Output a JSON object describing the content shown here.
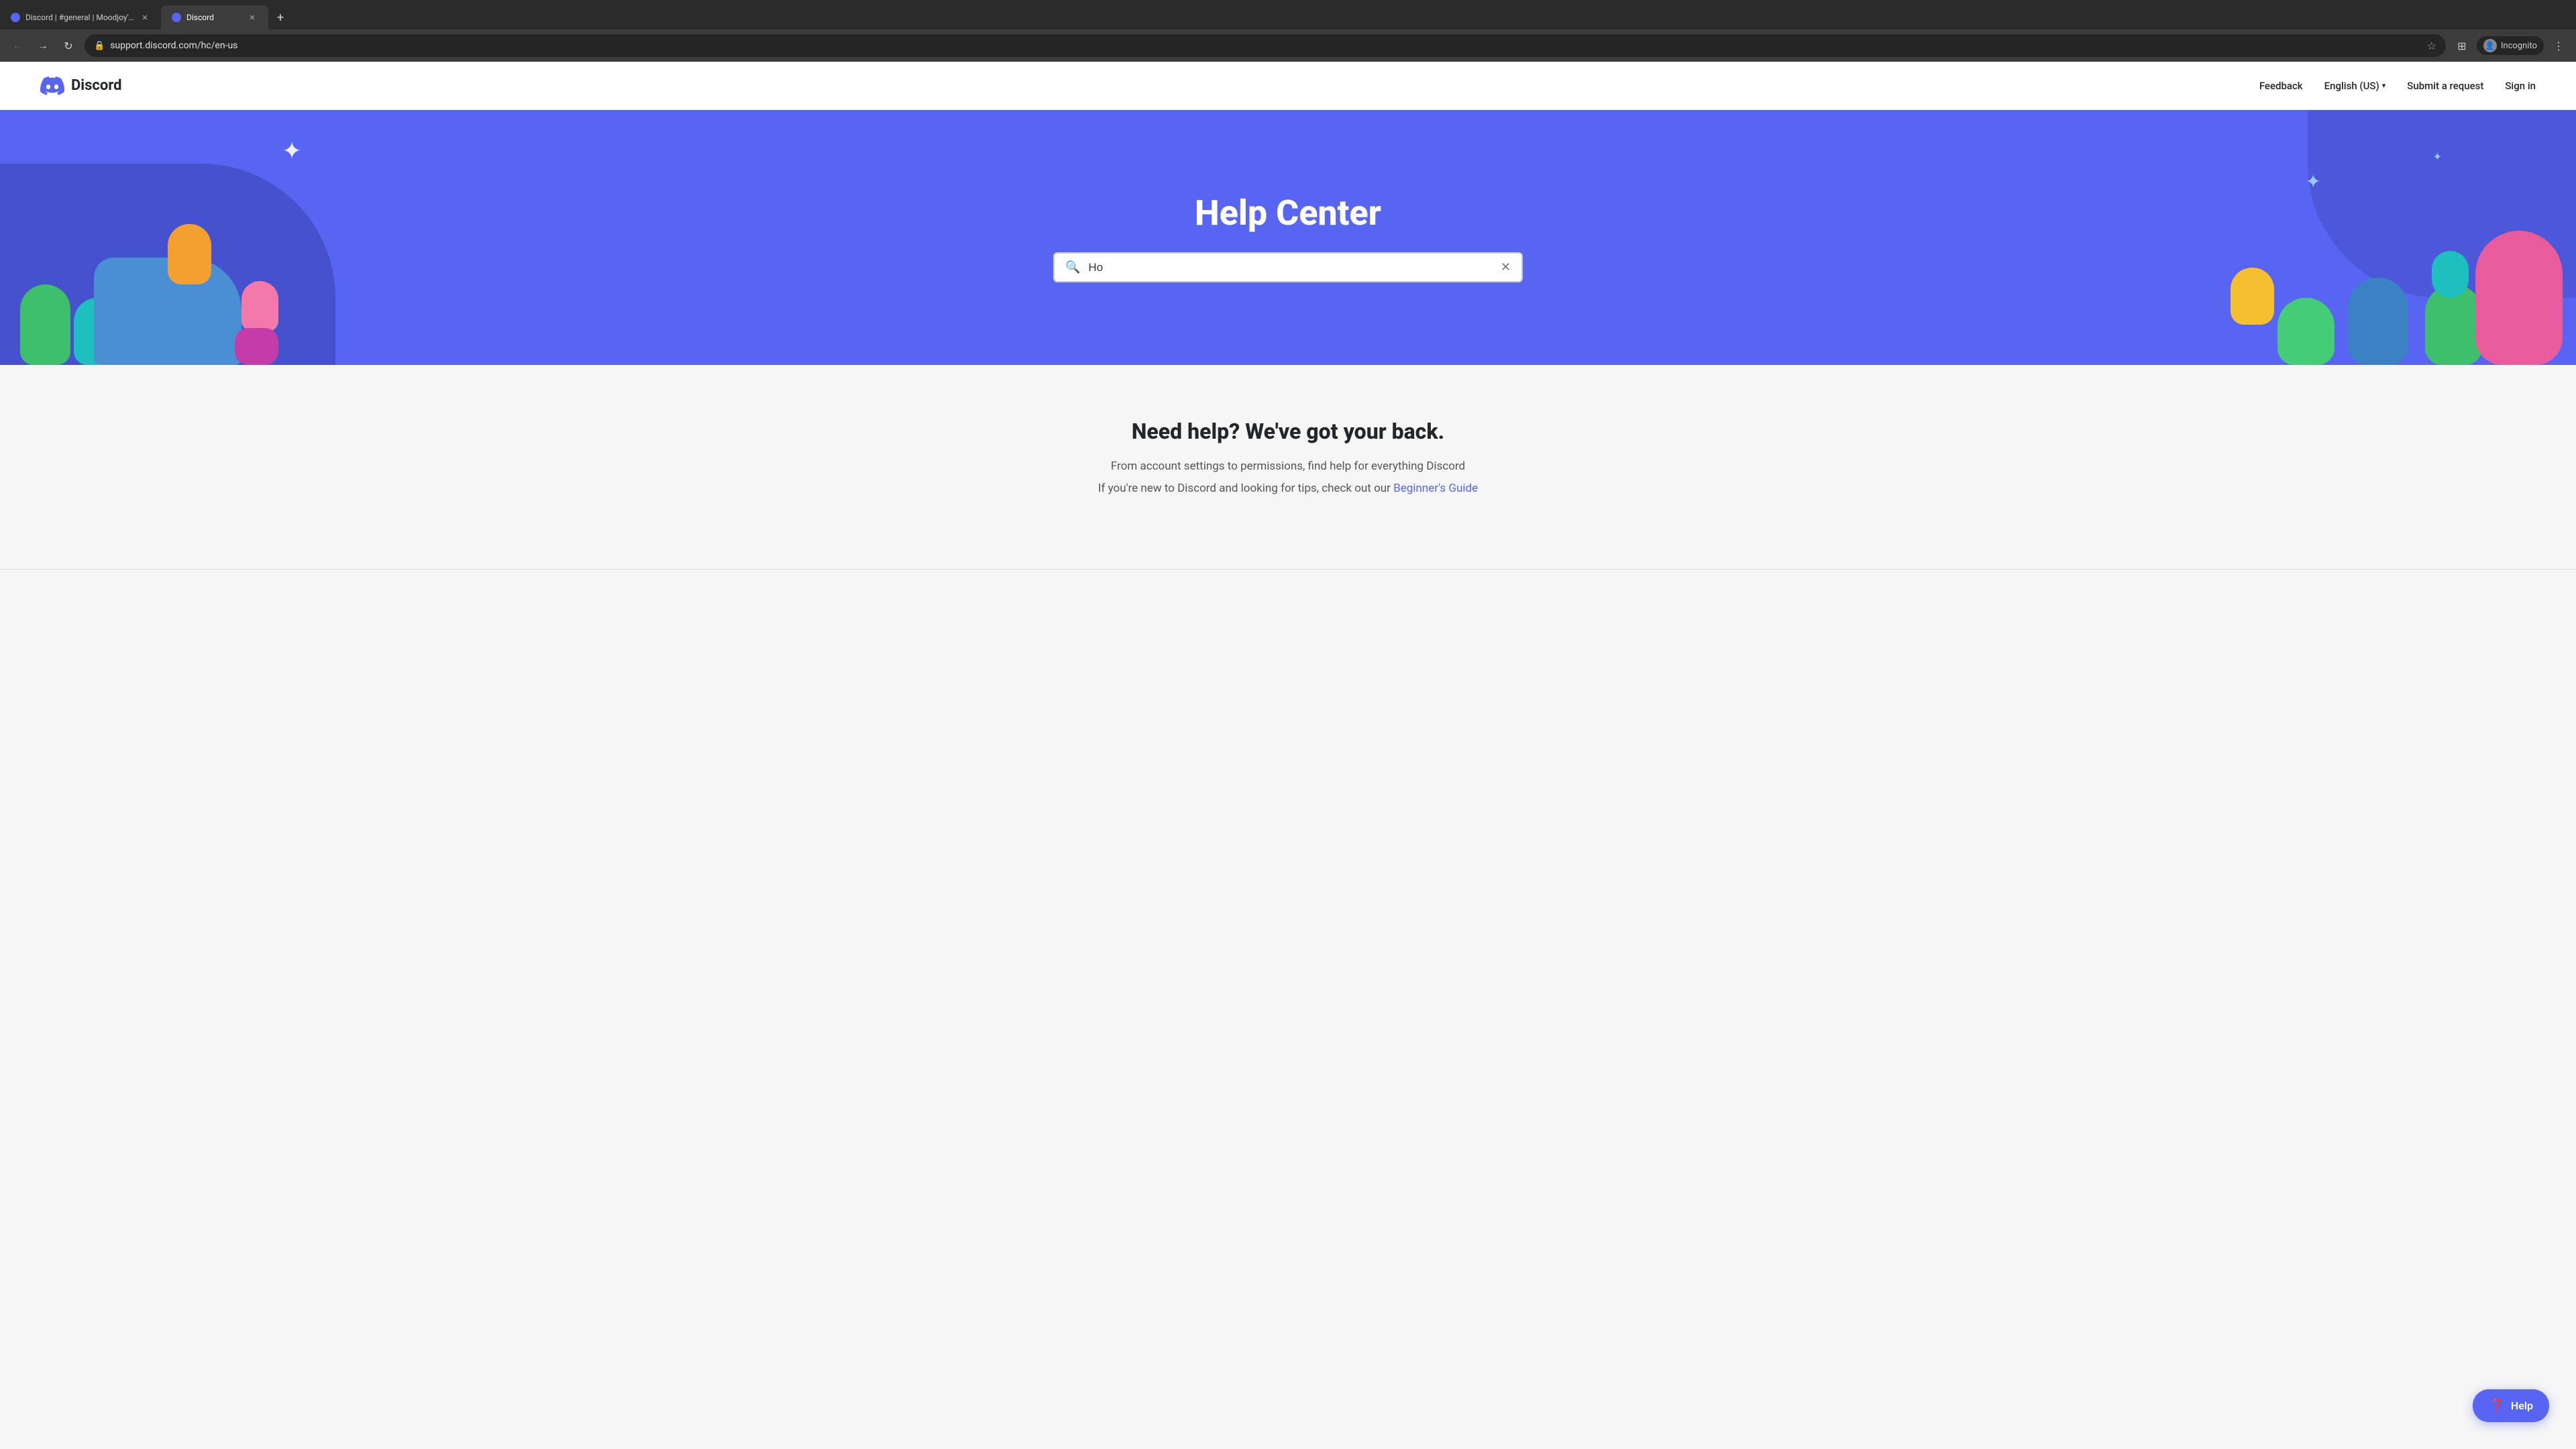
{
  "browser": {
    "tabs": [
      {
        "id": "tab1",
        "title": "Discord | #general | Moodjoy's...",
        "favicon": "discord-general",
        "active": false
      },
      {
        "id": "tab2",
        "title": "Discord",
        "favicon": "discord-support",
        "active": true
      }
    ],
    "new_tab_label": "+",
    "address": "support.discord.com/hc/en-us",
    "incognito_label": "Incognito"
  },
  "nav": {
    "logo_text": "Discord",
    "links": {
      "feedback": "Feedback",
      "language": "English (US)",
      "submit_request": "Submit a request",
      "sign_in": "Sign in"
    }
  },
  "hero": {
    "title": "Help Center",
    "search_placeholder": "Ho",
    "search_value": "Ho"
  },
  "main": {
    "section_title": "Need help? We've got your back.",
    "description_line1": "From account settings to permissions, find help for everything Discord",
    "description_line2": "If you're new to Discord and looking for tips, check out our ",
    "beginner_link": "Beginner's Guide"
  },
  "fab": {
    "label": "Help",
    "icon": "?"
  }
}
